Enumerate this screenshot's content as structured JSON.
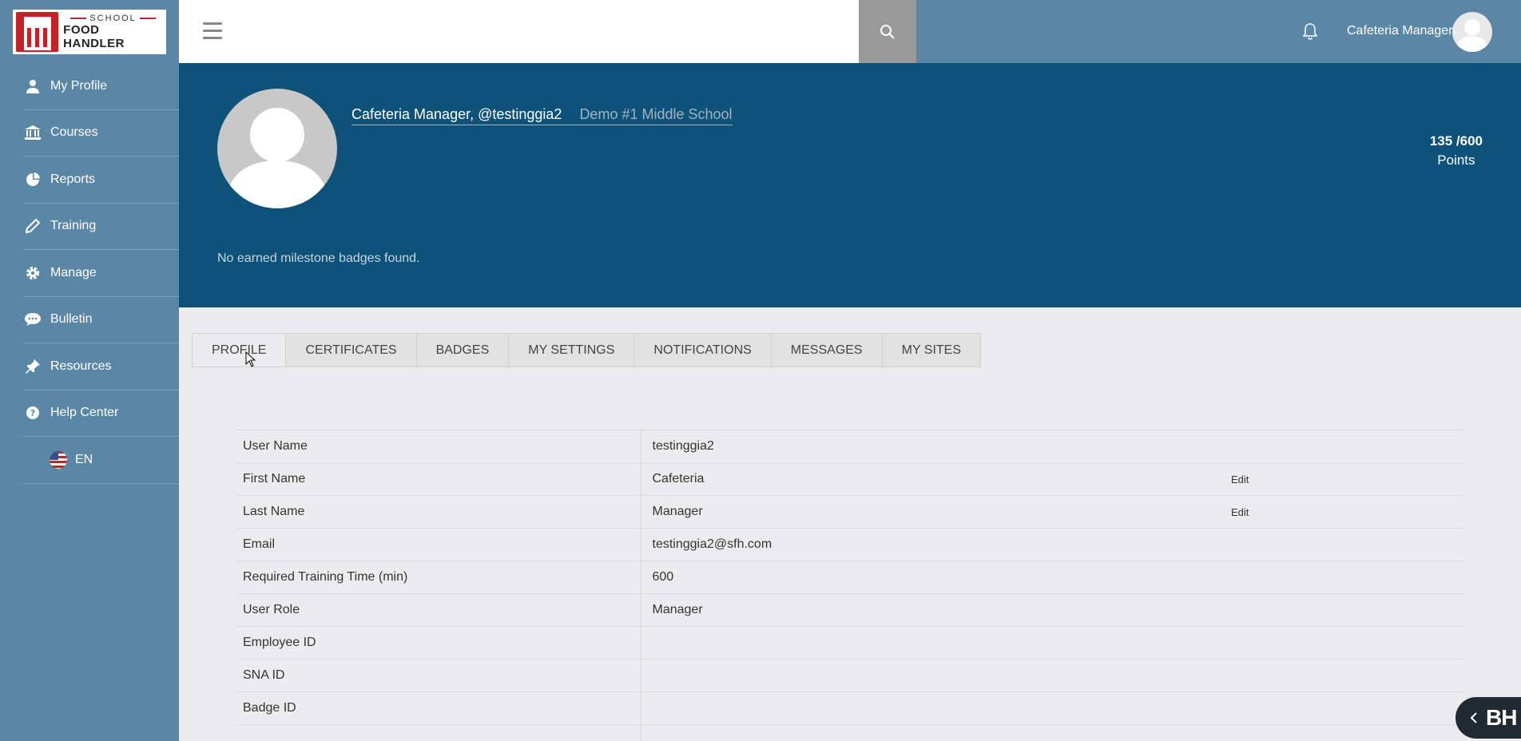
{
  "brand": {
    "line1": "SCHOOL",
    "line2": "FOOD HANDLER",
    "accent": "#c62127"
  },
  "sidebar": {
    "items": [
      {
        "label": "My Profile",
        "icon": "user-icon"
      },
      {
        "label": "Courses",
        "icon": "bank-icon"
      },
      {
        "label": "Reports",
        "icon": "pie-chart-icon"
      },
      {
        "label": "Training",
        "icon": "pencil-icon"
      },
      {
        "label": "Manage",
        "icon": "gear-icon"
      },
      {
        "label": "Bulletin",
        "icon": "chat-icon"
      },
      {
        "label": "Resources",
        "icon": "pin-icon"
      },
      {
        "label": "Help Center",
        "icon": "help-icon"
      }
    ],
    "language": "EN"
  },
  "topbar": {
    "user_name": "Cafeteria Manager"
  },
  "banner": {
    "name": "Cafeteria Manager, @testinggia2",
    "school": "Demo #1 Middle School",
    "points_value": "135 /600",
    "points_label": "Points",
    "badges_message": "No earned milestone badges found."
  },
  "tabs": [
    "PROFILE",
    "CERTIFICATES",
    "BADGES",
    "MY SETTINGS",
    "NOTIFICATIONS",
    "MESSAGES",
    "MY SITES"
  ],
  "profile": {
    "edit_label": "Edit",
    "rows": [
      {
        "key": "User Name",
        "value": "testinggia2",
        "editable": false
      },
      {
        "key": "First Name",
        "value": "Cafeteria",
        "editable": true
      },
      {
        "key": "Last Name",
        "value": "Manager",
        "editable": true
      },
      {
        "key": "Email",
        "value": "testinggia2@sfh.com",
        "editable": false
      },
      {
        "key": "Required Training Time (min)",
        "value": "600",
        "editable": false
      },
      {
        "key": "User Role",
        "value": "Manager",
        "editable": false
      },
      {
        "key": "Employee ID",
        "value": "",
        "editable": false
      },
      {
        "key": "SNA ID",
        "value": "",
        "editable": false
      },
      {
        "key": "Badge ID",
        "value": "",
        "editable": false
      }
    ]
  },
  "widget": {
    "label": "BH"
  }
}
